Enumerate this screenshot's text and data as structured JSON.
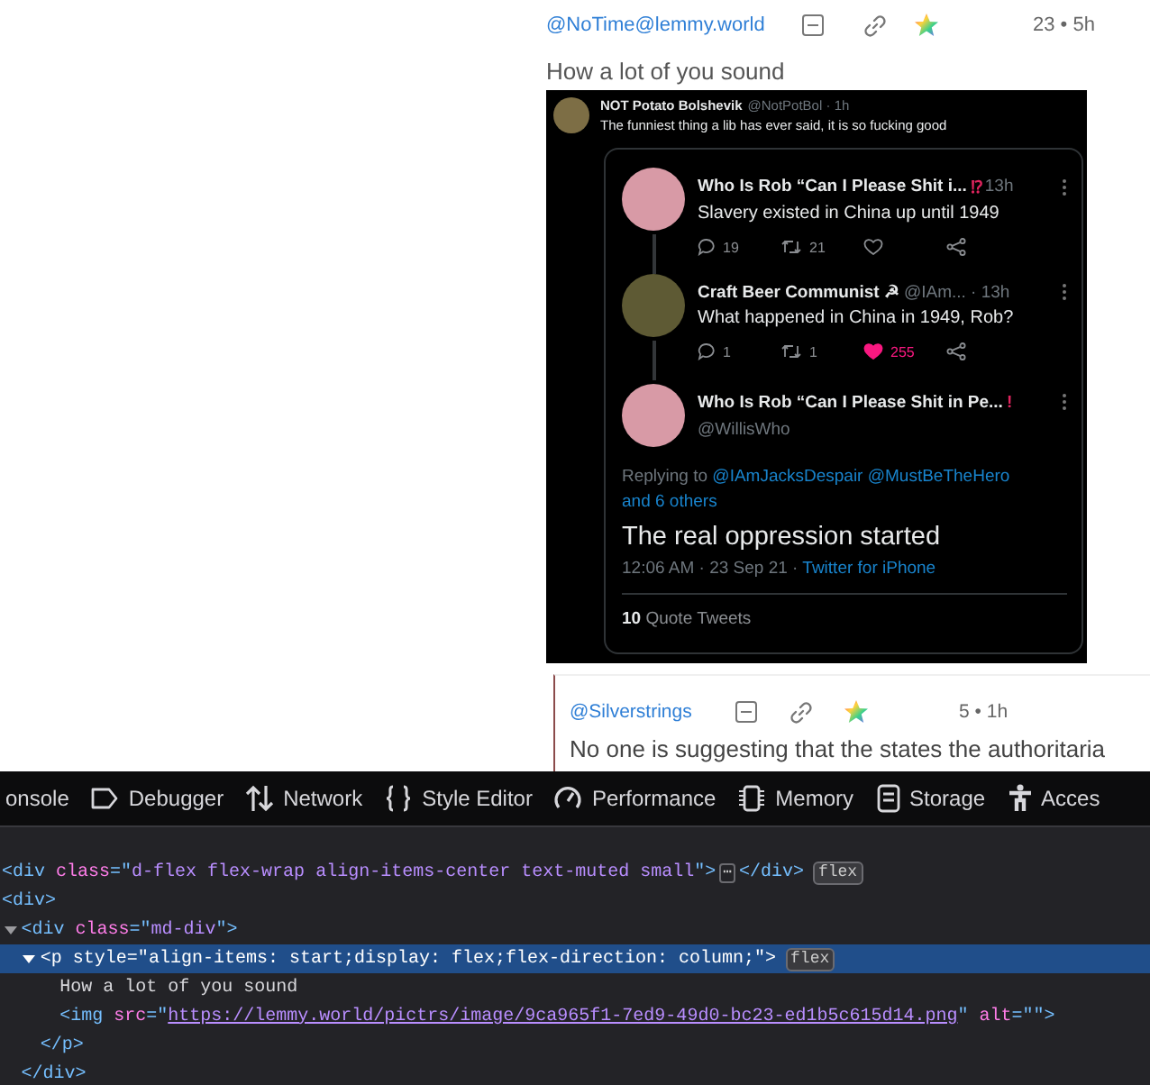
{
  "comments": [
    {
      "author": "@NoTime@lemmy.world",
      "score_time": "23 • 5h",
      "body": "How a lot of you sound",
      "tweet_image": {
        "author": "NOT Potato Bolshevik",
        "meta": "@NotPotBol · 1h",
        "color": "#7d6e45",
        "text": "The funniest thing a lib has ever said, it is so fucking good",
        "thread": [
          {
            "kind": "reply",
            "name": "Who Is Rob “Can I Please Shit i...",
            "flag": "⁉",
            "meta": "13h",
            "color": "#d89aa6",
            "text": "Slavery existed in China up until 1949",
            "replies": "19",
            "retweets": "21",
            "liked": false
          },
          {
            "kind": "reply",
            "name": "Craft Beer Communist ☭",
            "meta": "@IAm... · 13h",
            "color": "#5e5a34",
            "text": "What happened in China in 1949, Rob?",
            "replies": "1",
            "retweets": "1",
            "likes": "255",
            "liked": true
          },
          {
            "kind": "main",
            "name": "Who Is Rob “Can I Please Shit in Pe...",
            "flag": "!",
            "handle": "@WillisWho",
            "color": "#d89aa6",
            "reply_label": "Replying to",
            "reply_targets": "@IAmJacksDespair @MustBeTheHero",
            "reply_more": "and 6 others",
            "text": "The real oppression started",
            "time": "12:06 AM · 23 Sep 21 ·",
            "source": "Twitter for iPhone",
            "quotes": "**10** Quote Tweets"
          }
        ]
      }
    },
    {
      "author": "@Silverstrings",
      "score_time": "5 • 1h",
      "body": "No one is suggesting that the states the authoritaria"
    }
  ],
  "devtools": {
    "tabs": [
      {
        "label": "onsole",
        "selected": false
      },
      {
        "label": "Debugger",
        "selected": false
      },
      {
        "label": "Network",
        "selected": false
      },
      {
        "label": "Style Editor",
        "selected": false
      },
      {
        "label": "Performance",
        "selected": false
      },
      {
        "label": "Memory",
        "selected": false
      },
      {
        "label": "Storage",
        "selected": false
      },
      {
        "label": "Acces",
        "selected": false
      }
    ],
    "nodes": [
      {
        "selected": false,
        "tokens": [
          {
            "kind": "tag",
            "text": "<div "
          },
          {
            "kind": "attr",
            "text": "class"
          },
          {
            "kind": "tag",
            "text": "=\""
          },
          {
            "kind": "value",
            "text": "d-flex flex-wrap align-items-center text-muted small"
          },
          {
            "kind": "tag",
            "text": "\">"
          },
          {
            "kind": "ellipsis",
            "text": "⋯"
          },
          {
            "kind": "tag",
            "text": "</div>"
          },
          {
            "kind": "badge",
            "text": "flex"
          }
        ]
      },
      {
        "selected": false,
        "tokens": [
          {
            "kind": "tag",
            "text": "<div>"
          }
        ],
        "children": [
          {
            "selected": false,
            "expanded": true,
            "tokens": [
              {
                "kind": "tag",
                "text": "<div "
              },
              {
                "kind": "attr",
                "text": "class"
              },
              {
                "kind": "tag",
                "text": "=\""
              },
              {
                "kind": "value",
                "text": "md-div"
              },
              {
                "kind": "tag",
                "text": "\">"
              }
            ],
            "children": [
              {
                "selected": true,
                "expanded": true,
                "tokens": [
                  {
                    "kind": "tag",
                    "text": "<p "
                  },
                  {
                    "kind": "attr",
                    "text": "style"
                  },
                  {
                    "kind": "tag",
                    "text": "=\""
                  },
                  {
                    "kind": "value",
                    "text": "align-items: start;display: flex;flex-direction: column;"
                  },
                  {
                    "kind": "tag",
                    "text": "\">"
                  },
                  {
                    "kind": "badge",
                    "text": "flex"
                  }
                ],
                "children": [
                  {
                    "selected": false,
                    "tokens": [
                      {
                        "kind": "text",
                        "text": "How a lot of you sound"
                      }
                    ]
                  },
                  {
                    "selected": false,
                    "tokens": [
                      {
                        "kind": "tag",
                        "text": "<img "
                      },
                      {
                        "kind": "attr",
                        "text": "src"
                      },
                      {
                        "kind": "tag",
                        "text": "=\""
                      },
                      {
                        "kind": "link",
                        "text": "https://lemmy.world/pictrs/image/9ca965f1-7ed9-49d0-bc23-ed1b5c615d14.png"
                      },
                      {
                        "kind": "tag",
                        "text": "\" "
                      },
                      {
                        "kind": "attr",
                        "text": "alt"
                      },
                      {
                        "kind": "tag",
                        "text": "=\"\">"
                      }
                    ]
                  }
                ],
                "close": [
                  {
                    "kind": "tag",
                    "text": "</p>"
                  }
                ]
              }
            ],
            "close": [
              {
                "kind": "tag",
                "text": "</div>"
              }
            ]
          }
        ]
      }
    ]
  }
}
